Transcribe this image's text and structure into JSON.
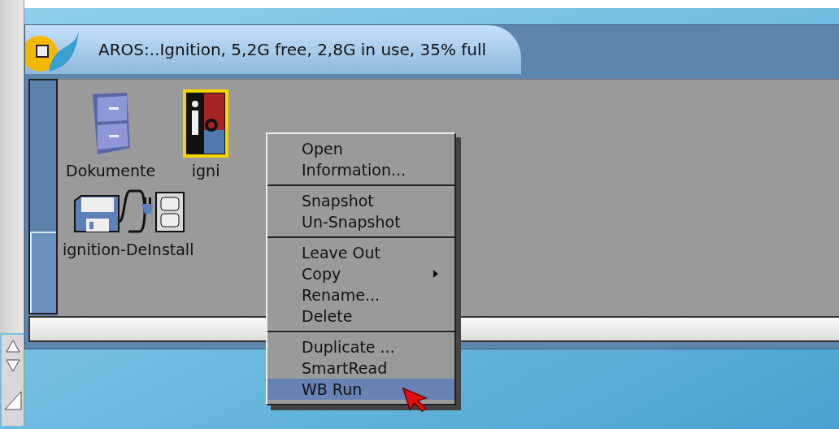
{
  "window": {
    "title": "AROS:..Ignition,  5,2G free, 2,8G in use, 35% full"
  },
  "icons": [
    {
      "label": "Dokumente",
      "kind": "cabinet",
      "selected": false
    },
    {
      "label": "igni",
      "kind": "logo",
      "selected": true
    },
    {
      "label": "ignition-DeInstall",
      "kind": "installer",
      "selected": false
    }
  ],
  "context_menu": {
    "groups": [
      {
        "items": [
          {
            "label": "Open",
            "kind": "plain",
            "selected": false
          },
          {
            "label": "Information...",
            "kind": "plain",
            "selected": false
          }
        ]
      },
      {
        "items": [
          {
            "label": "Snapshot",
            "kind": "plain",
            "selected": false
          },
          {
            "label": "Un-Snapshot",
            "kind": "plain",
            "selected": false
          }
        ]
      },
      {
        "items": [
          {
            "label": "Leave Out",
            "kind": "plain",
            "selected": false
          },
          {
            "label": "Copy",
            "kind": "submenu",
            "selected": false
          },
          {
            "label": "Rename...",
            "kind": "plain",
            "selected": false
          },
          {
            "label": "Delete",
            "kind": "plain",
            "selected": false
          }
        ]
      },
      {
        "items": [
          {
            "label": "Duplicate ...",
            "kind": "plain",
            "selected": false
          },
          {
            "label": "SmartRead",
            "kind": "plain",
            "selected": false
          },
          {
            "label": "WB Run",
            "kind": "plain",
            "selected": true
          }
        ]
      }
    ]
  }
}
